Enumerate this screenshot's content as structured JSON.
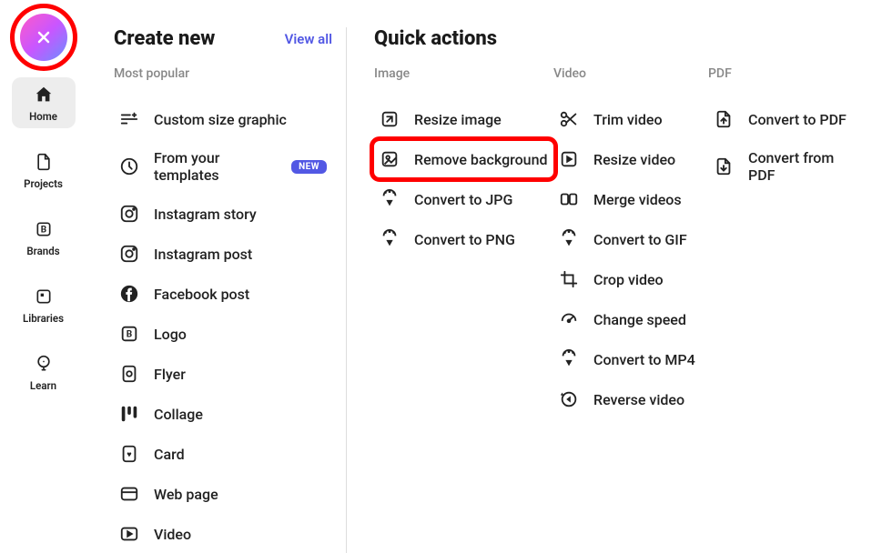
{
  "sidebar": {
    "items": [
      {
        "label": "Home"
      },
      {
        "label": "Projects"
      },
      {
        "label": "Brands"
      },
      {
        "label": "Libraries"
      },
      {
        "label": "Learn"
      }
    ]
  },
  "create_new": {
    "title": "Create new",
    "view_all": "View all",
    "subheading": "Most popular",
    "items": [
      {
        "label": "Custom size graphic"
      },
      {
        "label": "From your templates",
        "badge": "NEW"
      },
      {
        "label": "Instagram story"
      },
      {
        "label": "Instagram post"
      },
      {
        "label": "Facebook post"
      },
      {
        "label": "Logo"
      },
      {
        "label": "Flyer"
      },
      {
        "label": "Collage"
      },
      {
        "label": "Card"
      },
      {
        "label": "Web page"
      },
      {
        "label": "Video"
      }
    ]
  },
  "quick_actions": {
    "title": "Quick actions",
    "columns": [
      {
        "heading": "Image",
        "items": [
          {
            "label": "Resize image"
          },
          {
            "label": "Remove background"
          },
          {
            "label": "Convert to JPG"
          },
          {
            "label": "Convert to PNG"
          }
        ]
      },
      {
        "heading": "Video",
        "items": [
          {
            "label": "Trim video"
          },
          {
            "label": "Resize video"
          },
          {
            "label": "Merge videos"
          },
          {
            "label": "Convert to GIF"
          },
          {
            "label": "Crop video"
          },
          {
            "label": "Change speed"
          },
          {
            "label": "Convert to MP4"
          },
          {
            "label": "Reverse video"
          }
        ]
      },
      {
        "heading": "PDF",
        "items": [
          {
            "label": "Convert to PDF"
          },
          {
            "label": "Convert from PDF"
          }
        ]
      }
    ]
  }
}
